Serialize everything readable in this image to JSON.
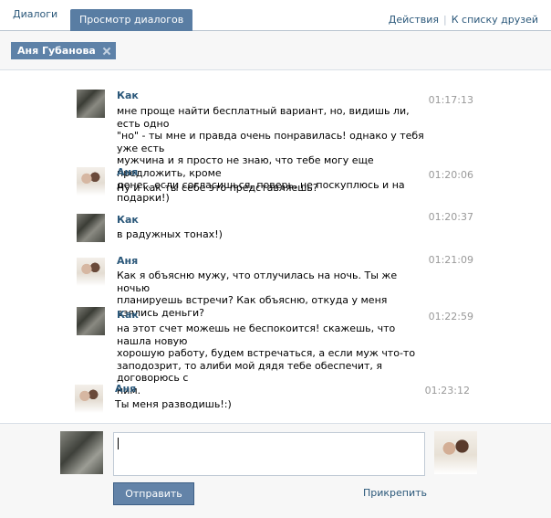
{
  "tabs": [
    {
      "label": "Диалоги"
    },
    {
      "label": "Просмотр диалогов"
    }
  ],
  "actions": {
    "actions_label": "Действия",
    "friends_label": "К списку друзей",
    "separator": "|"
  },
  "filter": {
    "chip_label": "Аня Губанова"
  },
  "messages": [
    {
      "author": "Как",
      "time": "01:17:13",
      "lines": [
        "мне проще найти бесплатный вариант, но, видишь ли, есть одно",
        "\"но\" - ты мне и правда очень понравилась! однако у тебя уже есть",
        "мужчина и я просто не знаю, что тебе могу еще предложить, кроме",
        "денег. если согласишься, поверь, не поскуплюсь и на подарки!)"
      ]
    },
    {
      "author": "Аня",
      "time": "01:20:06",
      "lines": [
        "Ну и как ты себе это представляешь?"
      ]
    },
    {
      "author": "Как",
      "time": "01:20:37",
      "lines": [
        "в радужных тонах!)"
      ]
    },
    {
      "author": "Аня",
      "time": "01:21:09",
      "lines": [
        "Как я объясню мужу, что отлучилась на ночь. Ты же ночью",
        "планируешь встречи? Как объясню, откуда у меня взялись деньги?"
      ]
    },
    {
      "author": "Как",
      "time": "01:22:59",
      "lines": [
        "на этот счет можешь не беспокоится! скажешь, что нашла новую",
        "хорошую работу, будем встречаться, а если муж что-то",
        "заподозрит, то алиби мой дядя тебе обеспечит, я договорюсь с",
        "ним."
      ]
    },
    {
      "author": "Аня",
      "time": "01:23:12",
      "lines": [
        "Ты меня разводишь!:)"
      ]
    }
  ],
  "composer": {
    "send_label": "Отправить",
    "attach_label": "Прикрепить"
  }
}
